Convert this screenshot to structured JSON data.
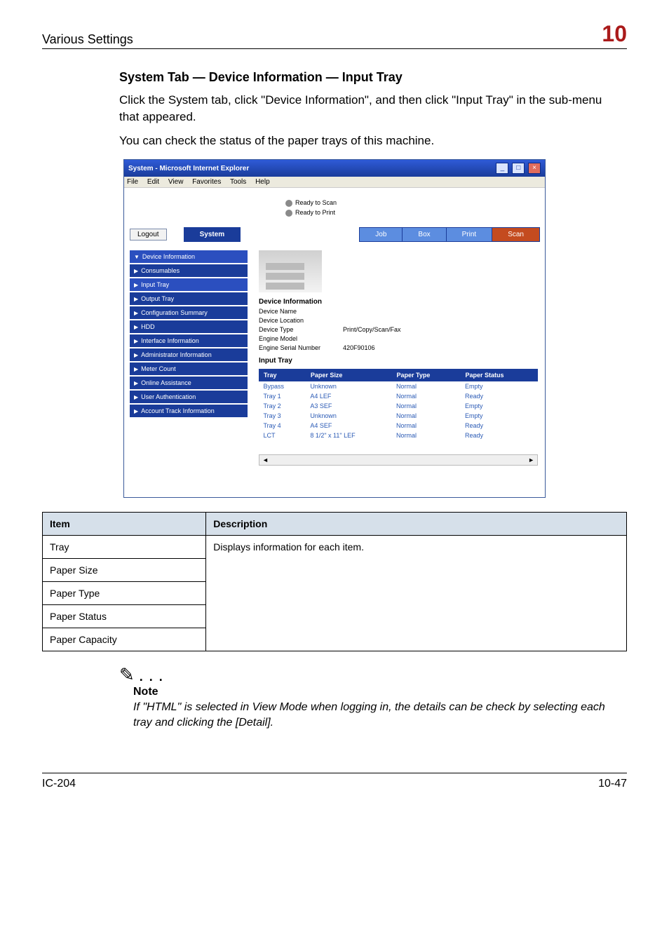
{
  "header": {
    "left": "Various Settings",
    "right": "10"
  },
  "heading": "System Tab — Device Information — Input Tray",
  "para1": "Click the System tab, click \"Device Information\", and then click \"Input Tray\" in the sub-menu that appeared.",
  "para2": "You can check the status of the paper trays of this machine.",
  "ie": {
    "title": "System - Microsoft Internet Explorer",
    "menus": [
      "File",
      "Edit",
      "View",
      "Favorites",
      "Tools",
      "Help"
    ],
    "status": {
      "scan": "Ready to Scan",
      "print": "Ready to Print"
    },
    "logout": "Logout",
    "tabs": {
      "system": "System",
      "job": "Job",
      "box": "Box",
      "print": "Print",
      "scan": "Scan"
    },
    "sidebar": [
      {
        "label": "Device Information",
        "mark": "▼"
      },
      {
        "label": "Consumables",
        "mark": "▶"
      },
      {
        "label": "Input Tray",
        "mark": "▶"
      },
      {
        "label": "Output Tray",
        "mark": "▶"
      },
      {
        "label": "Configuration Summary",
        "mark": "▶"
      },
      {
        "label": "HDD",
        "mark": "▶"
      },
      {
        "label": "Interface Information",
        "mark": "▶"
      },
      {
        "label": "Administrator Information",
        "mark": "▶"
      },
      {
        "label": "Meter Count",
        "mark": "▶"
      },
      {
        "label": "Online Assistance",
        "mark": "▶"
      },
      {
        "label": "User Authentication",
        "mark": "▶"
      },
      {
        "label": "Account Track Information",
        "mark": "▶"
      }
    ],
    "devinfo": {
      "title": "Device Information",
      "rows": {
        "device_name_k": "Device Name",
        "device_name_v": "",
        "device_loc_k": "Device Location",
        "device_loc_v": "",
        "device_type_k": "Device Type",
        "device_type_v": "Print/Copy/Scan/Fax",
        "engine_model_k": "Engine Model",
        "engine_model_v": "",
        "serial_k": "Engine Serial Number",
        "serial_v": "420F90106"
      }
    },
    "inputtray": {
      "title": "Input Tray",
      "headers": {
        "tray": "Tray",
        "size": "Paper Size",
        "type": "Paper Type",
        "status": "Paper Status"
      },
      "rows": [
        {
          "tray": "Bypass",
          "size": "Unknown",
          "type": "Normal",
          "status": "Empty"
        },
        {
          "tray": "Tray 1",
          "size": "A4 LEF",
          "type": "Normal",
          "status": "Ready"
        },
        {
          "tray": "Tray 2",
          "size": "A3 SEF",
          "type": "Normal",
          "status": "Empty"
        },
        {
          "tray": "Tray 3",
          "size": "Unknown",
          "type": "Normal",
          "status": "Empty"
        },
        {
          "tray": "Tray 4",
          "size": "A4 SEF",
          "type": "Normal",
          "status": "Ready"
        },
        {
          "tray": "LCT",
          "size": "8 1/2\" x 11\" LEF",
          "type": "Normal",
          "status": "Ready"
        }
      ]
    }
  },
  "info_table": {
    "head": {
      "item": "Item",
      "desc": "Description"
    },
    "desc_value": "Displays information for each item.",
    "rows": [
      "Tray",
      "Paper Size",
      "Paper Type",
      "Paper Status",
      "Paper Capacity"
    ]
  },
  "note": {
    "head": "Note",
    "body": "If \"HTML\" is selected in View Mode when logging in, the details can be check by selecting each tray and clicking the [Detail]."
  },
  "footer": {
    "left": "IC-204",
    "right": "10-47"
  }
}
